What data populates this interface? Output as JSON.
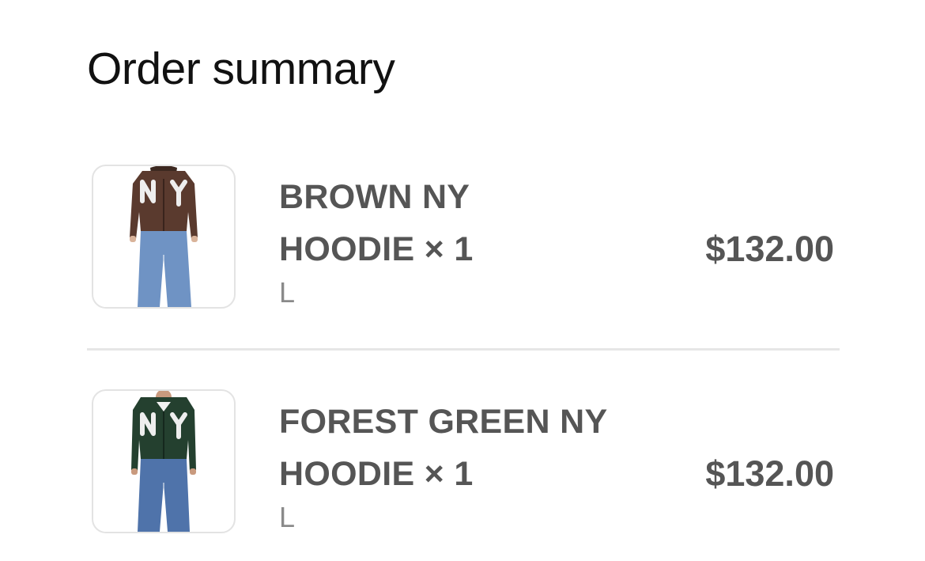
{
  "summary": {
    "title": "Order summary"
  },
  "items": [
    {
      "name_line1": "BROWN NY",
      "name_line2": "HOODIE × 1",
      "variant": "L",
      "price": "$132.00",
      "image_icon": "brown-ny-hoodie-image",
      "hoodie_color": "#5a3a2e"
    },
    {
      "name_line1": "FOREST GREEN NY",
      "name_line2": "HOODIE × 1",
      "variant": "L",
      "price": "$132.00",
      "image_icon": "forest-green-ny-hoodie-image",
      "hoodie_color": "#24402f"
    }
  ],
  "colors": {
    "title_text": "#111111",
    "item_text": "#555555",
    "variant_text": "#8a8a8a",
    "divider": "#e6e6e6",
    "thumb_border": "#e3e3e3",
    "jeans": "#6f93c4"
  }
}
